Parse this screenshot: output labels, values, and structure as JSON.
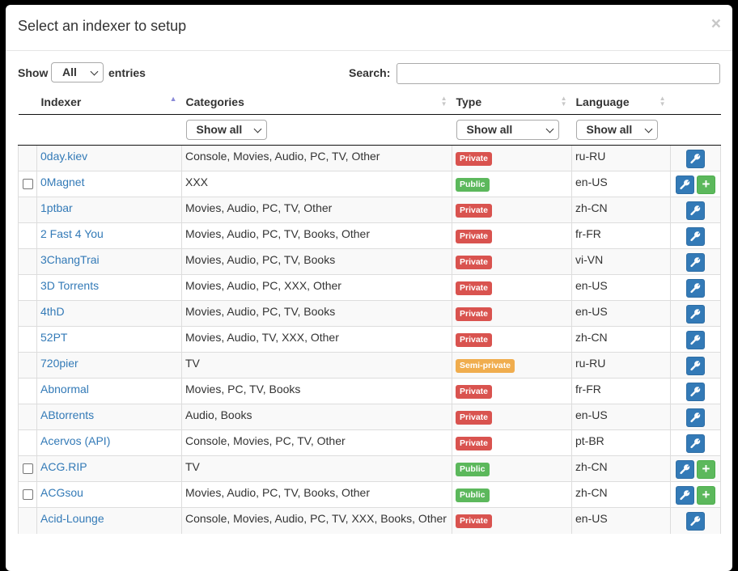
{
  "modal": {
    "title": "Select an indexer to setup",
    "close_label": "×"
  },
  "controls": {
    "show_label": "Show",
    "length_value": "All",
    "entries_label": "entries",
    "search_label": "Search:",
    "search_value": ""
  },
  "table": {
    "headers": [
      "Indexer",
      "Categories",
      "Type",
      "Language"
    ],
    "filters": [
      "Show all",
      "Show all",
      "Show all"
    ],
    "rows": [
      {
        "name": "0day.kiev",
        "categories": "Console, Movies, Audio, PC, TV, Other",
        "type": "Private",
        "language": "ru-RU",
        "checkbox": false,
        "add": false
      },
      {
        "name": "0Magnet",
        "categories": "XXX",
        "type": "Public",
        "language": "en-US",
        "checkbox": true,
        "add": true
      },
      {
        "name": "1ptbar",
        "categories": "Movies, Audio, PC, TV, Other",
        "type": "Private",
        "language": "zh-CN",
        "checkbox": false,
        "add": false
      },
      {
        "name": "2 Fast 4 You",
        "categories": "Movies, Audio, PC, TV, Books, Other",
        "type": "Private",
        "language": "fr-FR",
        "checkbox": false,
        "add": false
      },
      {
        "name": "3ChangTrai",
        "categories": "Movies, Audio, PC, TV, Books",
        "type": "Private",
        "language": "vi-VN",
        "checkbox": false,
        "add": false
      },
      {
        "name": "3D Torrents",
        "categories": "Movies, Audio, PC, XXX, Other",
        "type": "Private",
        "language": "en-US",
        "checkbox": false,
        "add": false
      },
      {
        "name": "4thD",
        "categories": "Movies, Audio, PC, TV, Books",
        "type": "Private",
        "language": "en-US",
        "checkbox": false,
        "add": false
      },
      {
        "name": "52PT",
        "categories": "Movies, Audio, TV, XXX, Other",
        "type": "Private",
        "language": "zh-CN",
        "checkbox": false,
        "add": false
      },
      {
        "name": "720pier",
        "categories": "TV",
        "type": "Semi-private",
        "language": "ru-RU",
        "checkbox": false,
        "add": false
      },
      {
        "name": "Abnormal",
        "categories": "Movies, PC, TV, Books",
        "type": "Private",
        "language": "fr-FR",
        "checkbox": false,
        "add": false
      },
      {
        "name": "ABtorrents",
        "categories": "Audio, Books",
        "type": "Private",
        "language": "en-US",
        "checkbox": false,
        "add": false
      },
      {
        "name": "Acervos (API)",
        "categories": "Console, Movies, PC, TV, Other",
        "type": "Private",
        "language": "pt-BR",
        "checkbox": false,
        "add": false
      },
      {
        "name": "ACG.RIP",
        "categories": "TV",
        "type": "Public",
        "language": "zh-CN",
        "checkbox": true,
        "add": true
      },
      {
        "name": "ACGsou",
        "categories": "Movies, Audio, PC, TV, Books, Other",
        "type": "Public",
        "language": "zh-CN",
        "checkbox": true,
        "add": true
      },
      {
        "name": "Acid-Lounge",
        "categories": "Console, Movies, Audio, PC, TV, XXX, Books, Other",
        "type": "Private",
        "language": "en-US",
        "checkbox": false,
        "add": false
      }
    ]
  },
  "colors": {
    "private": "#d9534f",
    "public": "#5cb85c",
    "semi_private": "#f0ad4e",
    "link": "#337ab7"
  },
  "icons": {
    "configure": "wrench-icon",
    "add": "plus-icon"
  }
}
